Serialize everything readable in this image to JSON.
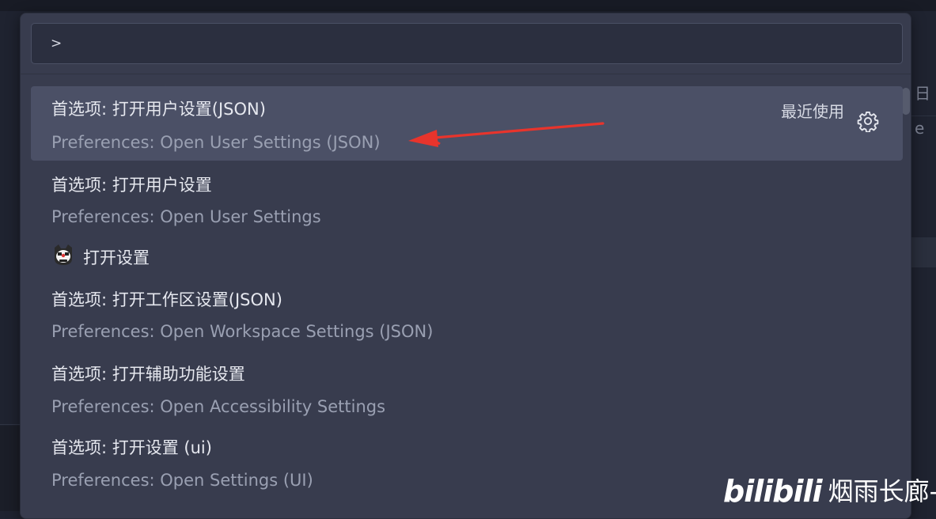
{
  "search": {
    "value": ">"
  },
  "items": [
    {
      "title": "首选项: 打开用户设置(JSON)",
      "subtitle": "Preferences: Open User Settings (JSON)",
      "badge": "最近使用",
      "icon": "gear-icon"
    },
    {
      "title": "首选项: 打开用户设置",
      "subtitle": "Preferences: Open User Settings"
    },
    {
      "title": "打开设置",
      "icon": "emoji-face-icon"
    },
    {
      "title": "首选项: 打开工作区设置(JSON)",
      "subtitle": "Preferences: Open Workspace Settings (JSON)"
    },
    {
      "title": "首选项: 打开辅助功能设置",
      "subtitle": "Preferences: Open Accessibility Settings"
    },
    {
      "title": "首选项: 打开设置 (ui)",
      "subtitle": "Preferences: Open Settings (UI)"
    }
  ],
  "background": {
    "right_tab_text": "日 e"
  },
  "watermark": {
    "logo": "bilibili",
    "text": "烟雨长廊-"
  },
  "colors": {
    "selected_row": "#4b5066",
    "arrow": "#e8342c",
    "palette_bg": "#383c4e"
  }
}
